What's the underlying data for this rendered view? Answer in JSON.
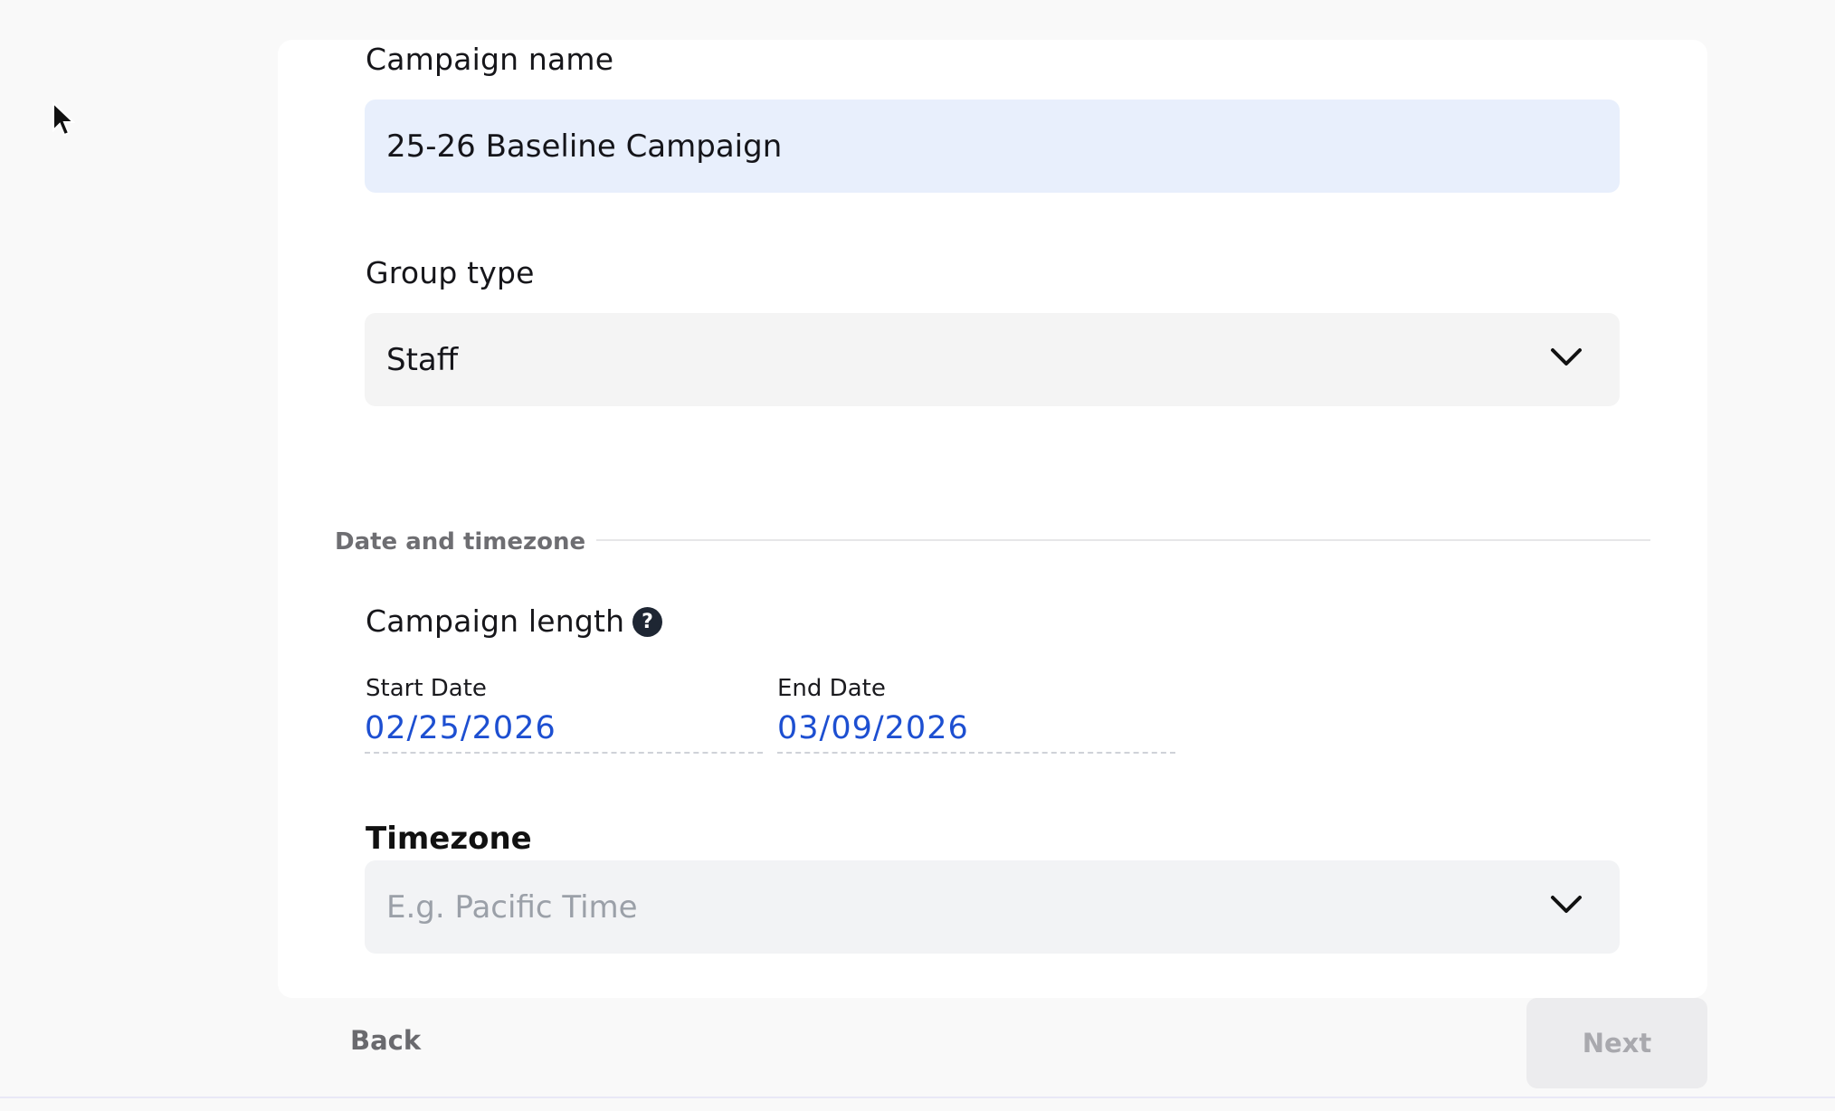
{
  "form": {
    "campaign_name_label": "Campaign name",
    "campaign_name_value": "25-26 Baseline Campaign",
    "group_type_label": "Group type",
    "group_type_value": "Staff",
    "section_title": "Date and timezone",
    "campaign_length_label": "Campaign length",
    "help_glyph": "?",
    "start_date_label": "Start Date",
    "start_date_value": "02/25/2026",
    "end_date_label": "End Date",
    "end_date_value": "03/09/2026",
    "timezone_label": "Timezone",
    "timezone_placeholder": "E.g. Pacific Time"
  },
  "footer": {
    "back_label": "Back",
    "next_label": "Next"
  },
  "colors": {
    "accent_date": "#1d4fd1",
    "name_field_bg": "#e8effc",
    "help_icon_bg": "#1e2633"
  },
  "icons": [
    "mouse-cursor-icon",
    "chevron-down-icon",
    "help-icon"
  ]
}
